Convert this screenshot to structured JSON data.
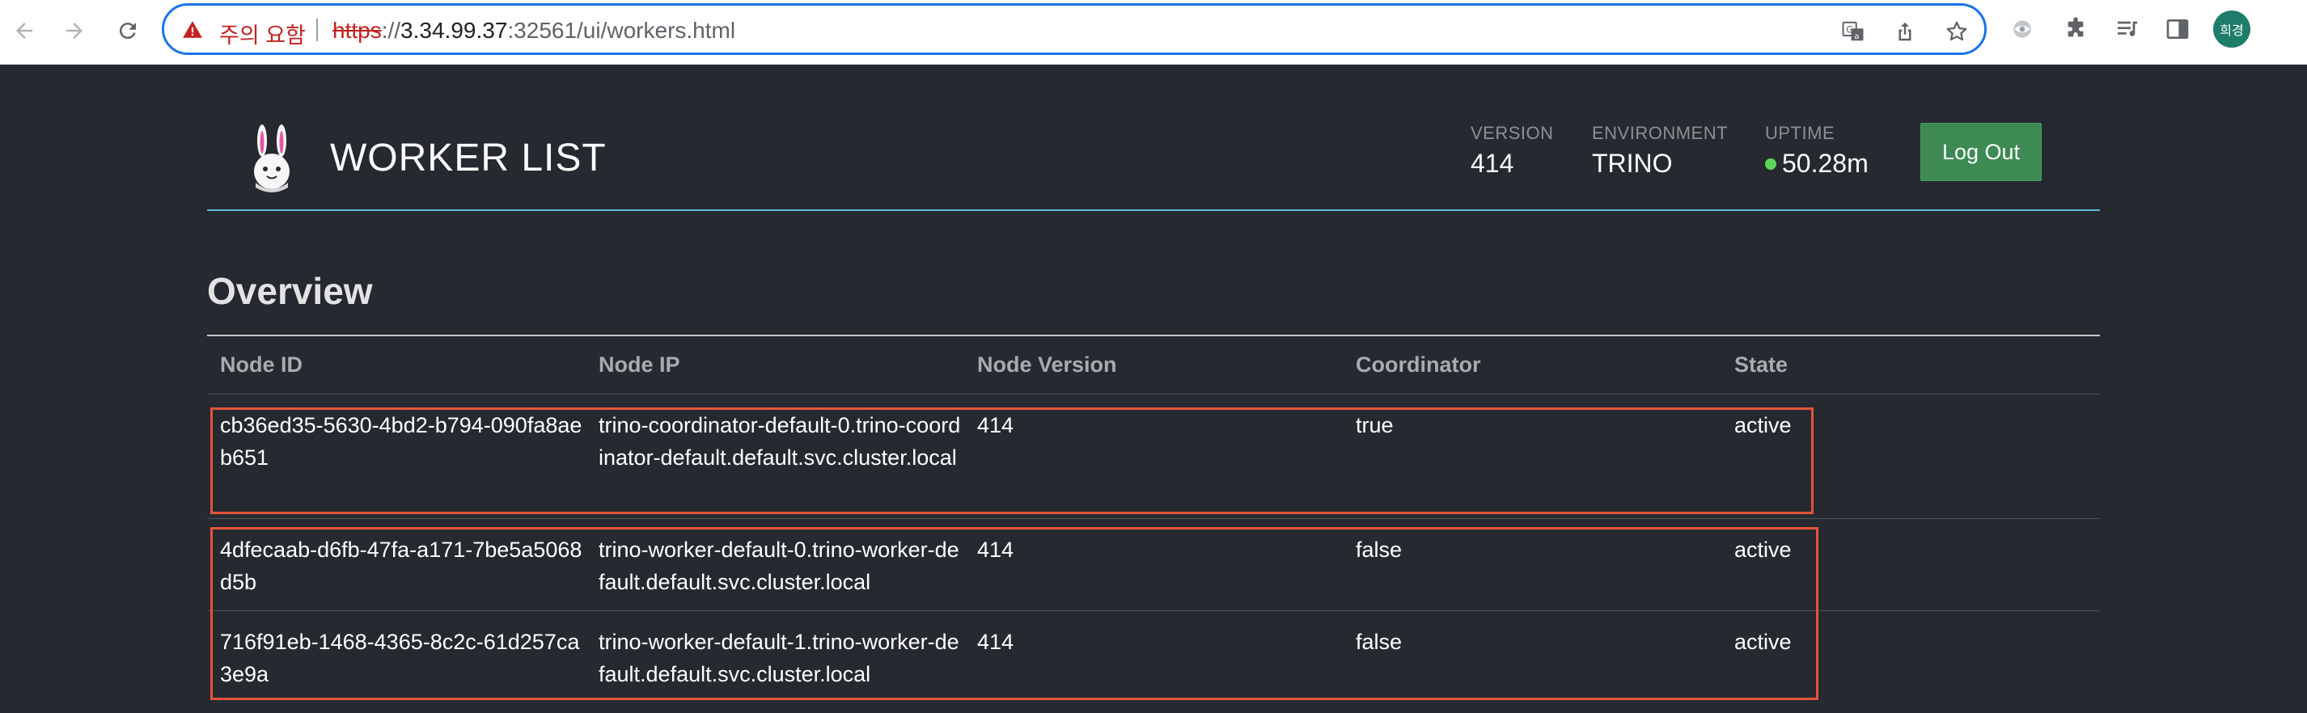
{
  "browser": {
    "security_warning": "주의 요함",
    "url_scheme": "https",
    "url_sep": "://",
    "url_host": "3.34.99.37",
    "url_rest": ":32561/ui/workers.html",
    "profile_initials": "희경"
  },
  "header": {
    "title": "WORKER LIST",
    "version_label": "VERSION",
    "version_value": "414",
    "environment_label": "ENVIRONMENT",
    "environment_value": "TRINO",
    "uptime_label": "UPTIME",
    "uptime_value": "50.28m",
    "logout_label": "Log Out"
  },
  "overview": {
    "title": "Overview",
    "columns": [
      "Node ID",
      "Node IP",
      "Node Version",
      "Coordinator",
      "State"
    ],
    "rows": [
      {
        "node_id": "cb36ed35-5630-4bd2-b794-090fa8aeb651",
        "node_ip": "trino-coordinator-default-0.trino-coordinator-default.default.svc.cluster.local",
        "node_version": "414",
        "coordinator": "true",
        "state": "active"
      },
      {
        "node_id": "4dfecaab-d6fb-47fa-a171-7be5a5068d5b",
        "node_ip": "trino-worker-default-0.trino-worker-default.default.svc.cluster.local",
        "node_version": "414",
        "coordinator": "false",
        "state": "active"
      },
      {
        "node_id": "716f91eb-1468-4365-8c2c-61d257ca3e9a",
        "node_ip": "trino-worker-default-1.trino-worker-default.default.svc.cluster.local",
        "node_version": "414",
        "coordinator": "false",
        "state": "active"
      }
    ]
  },
  "colors": {
    "page_background": "#262a30",
    "header_rule": "#5fb9d8",
    "logout_button": "#3d8a55",
    "uptime_indicator": "#5cd65c",
    "highlight_box": "#e4533a"
  }
}
